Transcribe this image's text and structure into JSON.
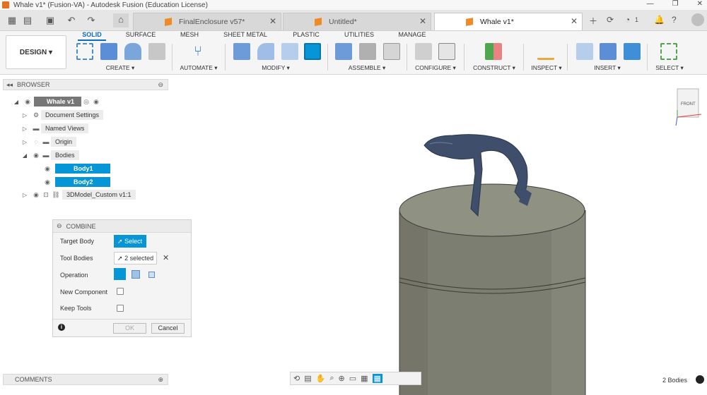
{
  "window": {
    "title": "Whale v1* (Fusion-VA) - Autodesk Fusion (Education License)",
    "controls": [
      "—",
      "❐",
      "✕"
    ]
  },
  "tabs": [
    {
      "label": "FinalEnclosure v57*",
      "active": false
    },
    {
      "label": "Untitled*",
      "active": false
    },
    {
      "label": "Whale v1*",
      "active": true
    }
  ],
  "tabbar_right": {
    "job_status_count": "1"
  },
  "ribbon": {
    "workspace": "DESIGN ▾",
    "tabs": [
      "SOLID",
      "SURFACE",
      "MESH",
      "SHEET METAL",
      "PLASTIC",
      "UTILITIES",
      "MANAGE"
    ],
    "active_tab": "SOLID",
    "groups": [
      "CREATE ▾",
      "AUTOMATE ▾",
      "MODIFY ▾",
      "ASSEMBLE ▾",
      "CONFIGURE ▾",
      "CONSTRUCT ▾",
      "INSPECT ▾",
      "INSERT ▾",
      "SELECT ▾"
    ]
  },
  "browser": {
    "title": "BROWSER",
    "root": "Whale v1",
    "items": [
      {
        "label": "Document Settings"
      },
      {
        "label": "Named Views"
      },
      {
        "label": "Origin"
      },
      {
        "label": "Bodies"
      },
      {
        "label": "Body1"
      },
      {
        "label": "Body2"
      },
      {
        "label": "3DModel_Custom v1:1"
      }
    ]
  },
  "combine": {
    "title": "COMBINE",
    "rows": {
      "target_body": "Target Body",
      "tool_bodies": "Tool Bodies",
      "operation": "Operation",
      "new_component": "New Component",
      "keep_tools": "Keep Tools"
    },
    "select_label": "Select",
    "tool_selection": "2 selected",
    "ok": "OK",
    "cancel": "Cancel"
  },
  "comments": {
    "title": "COMMENTS"
  },
  "viewcube": {
    "face": "FRONT"
  },
  "status": {
    "bodies": "2 Bodies"
  },
  "colors": {
    "accent": "#0696d7",
    "cylinder": "#7d7e72",
    "whale": "#3f4f6b"
  }
}
